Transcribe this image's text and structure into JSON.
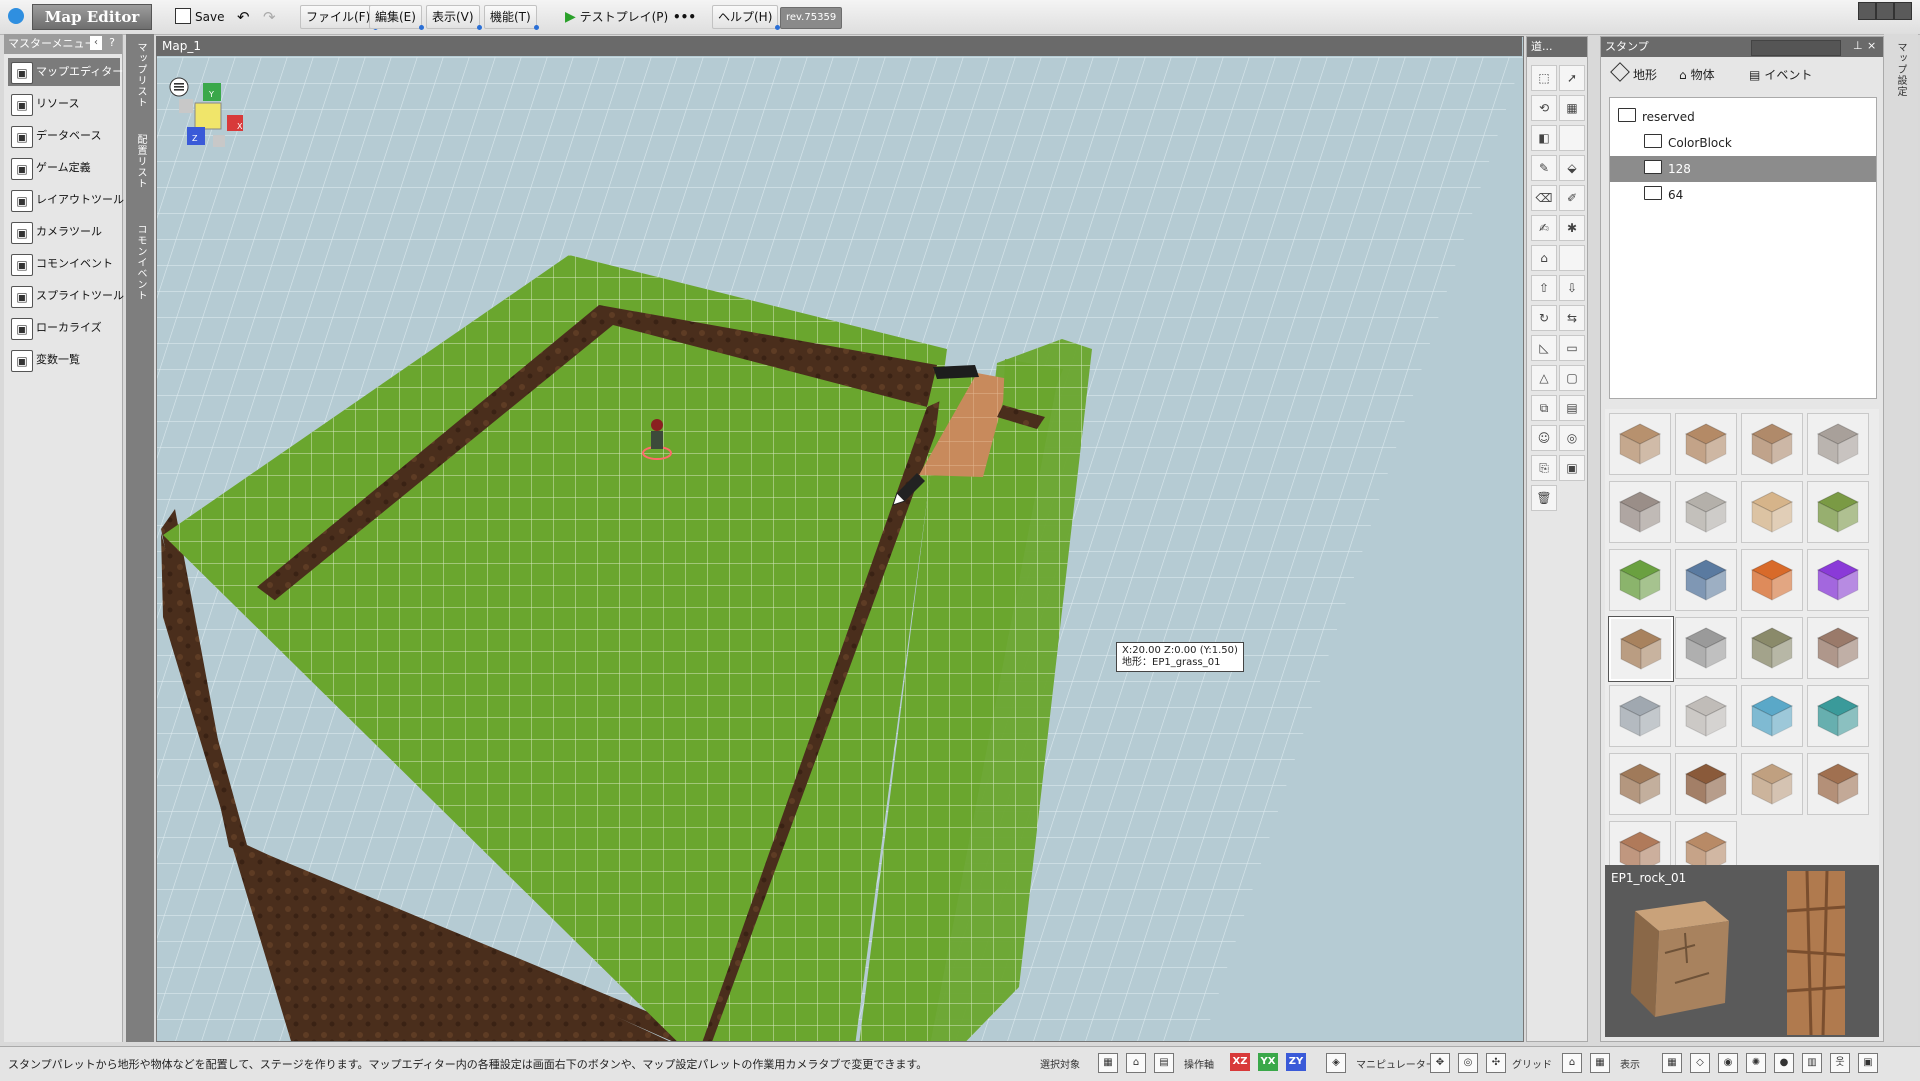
{
  "titlebar": {
    "app_title": "Map Editor",
    "save_label": "Save",
    "menus": [
      "ファイル(F)",
      "編集(E)",
      "表示(V)",
      "機能(T)"
    ],
    "testplay_label": "テストプレイ(P)",
    "more_label": "•••",
    "help_label": "ヘルプ(H)",
    "revision": "rev.75359"
  },
  "left_menu": {
    "header": "マスターメニュー",
    "items": [
      {
        "label": "マップエディター",
        "icon": "map-editor-icon",
        "active": true
      },
      {
        "label": "リソース",
        "icon": "resource-icon",
        "active": false
      },
      {
        "label": "データベース",
        "icon": "database-icon",
        "active": false
      },
      {
        "label": "ゲーム定義",
        "icon": "game-definition-icon",
        "active": false
      },
      {
        "label": "レイアウトツール",
        "icon": "layout-tool-icon",
        "active": false
      },
      {
        "label": "カメラツール",
        "icon": "camera-tool-icon",
        "active": false
      },
      {
        "label": "コモンイベント",
        "icon": "common-event-icon",
        "active": false
      },
      {
        "label": "スプライトツール",
        "icon": "sprite-tool-icon",
        "active": false
      },
      {
        "label": "ローカライズ",
        "icon": "localize-icon",
        "active": false
      },
      {
        "label": "変数一覧",
        "icon": "variable-list-icon",
        "active": false
      }
    ]
  },
  "vertical_tabs": [
    "マップリスト",
    "配置リスト",
    "コモンイベント"
  ],
  "viewport": {
    "title": "Map_1",
    "tooltip_line1": "X:20.00 Z:0.00 (Y:1.50)",
    "tooltip_line2": "地形：EP1_grass_01"
  },
  "tools_panel": {
    "title": "道..."
  },
  "stamp_panel": {
    "title": "スタンプ",
    "tabs": [
      "地形",
      "物体",
      "イベント"
    ],
    "tree": [
      {
        "label": "reserved",
        "depth": 0,
        "selected": false
      },
      {
        "label": "ColorBlock",
        "depth": 1,
        "selected": false
      },
      {
        "label": "128",
        "depth": 1,
        "selected": true
      },
      {
        "label": "64",
        "depth": 1,
        "selected": false
      }
    ],
    "preview_name": "EP1_rock_01"
  },
  "side_tab": "マップ設定",
  "statusbar": {
    "message": "スタンプパレットから地形や物体などを配置して、ステージを作ります。マップエディター内の各種設定は画面右下のボタンや、マップ設定パレットの作業用カメラタブで変更できます。",
    "select_target": "選択対象",
    "operation_axis": "操作軸",
    "axes": [
      "XZ",
      "YX",
      "ZY"
    ],
    "manipulator": "マニピュレーター",
    "grid": "グリッド",
    "display": "表示"
  },
  "colors": {
    "grass": "#6aa62e",
    "dirt": "#4a2e1c",
    "floor_grid": "#b8d0da",
    "axis_x": "#d83a3a",
    "axis_y": "#3aa84a",
    "axis_z": "#3a5ad8"
  }
}
